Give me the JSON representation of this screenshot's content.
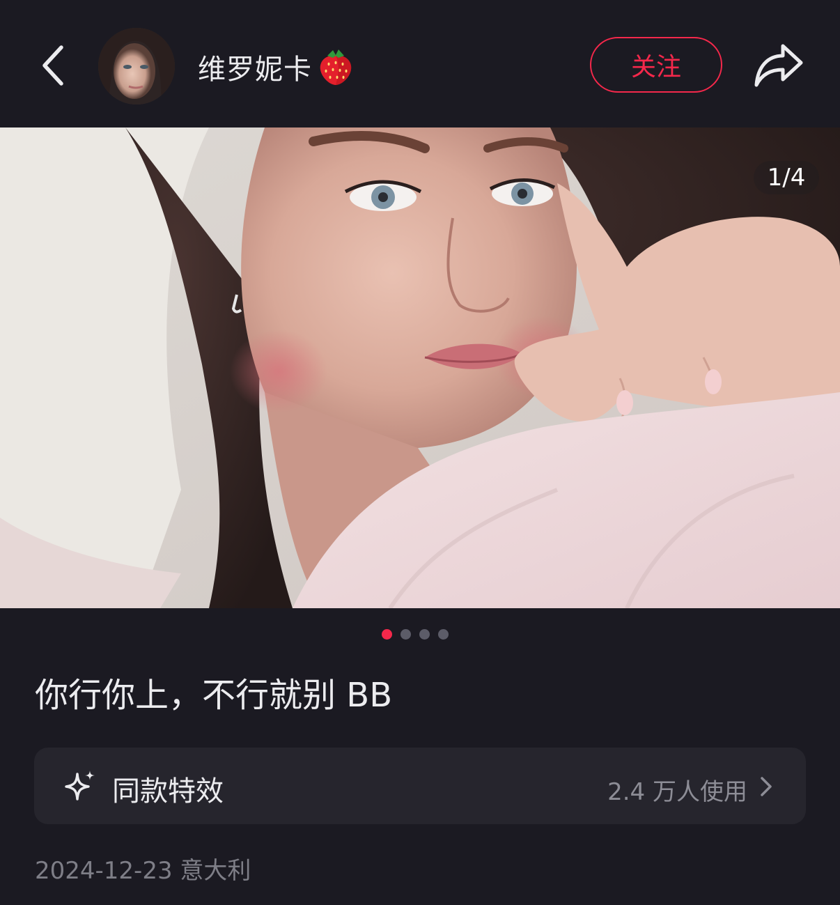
{
  "header": {
    "username": "维罗妮卡",
    "username_emoji": "strawberry",
    "follow_label": "关注",
    "back_icon": "chevron-left-icon",
    "share_icon": "share-arrow-icon"
  },
  "post": {
    "image_counter": "1/4",
    "total_images": 4,
    "current_index": 1,
    "caption": "你行你上，不行就别 BB"
  },
  "effect": {
    "label": "同款特效",
    "usage": "2.4 万人使用",
    "icon": "sparkle-icon"
  },
  "meta": {
    "date_location": "2024-12-23 意大利"
  },
  "colors": {
    "background": "#1b1a22",
    "accent": "#f5284b",
    "card": "#26252d"
  }
}
